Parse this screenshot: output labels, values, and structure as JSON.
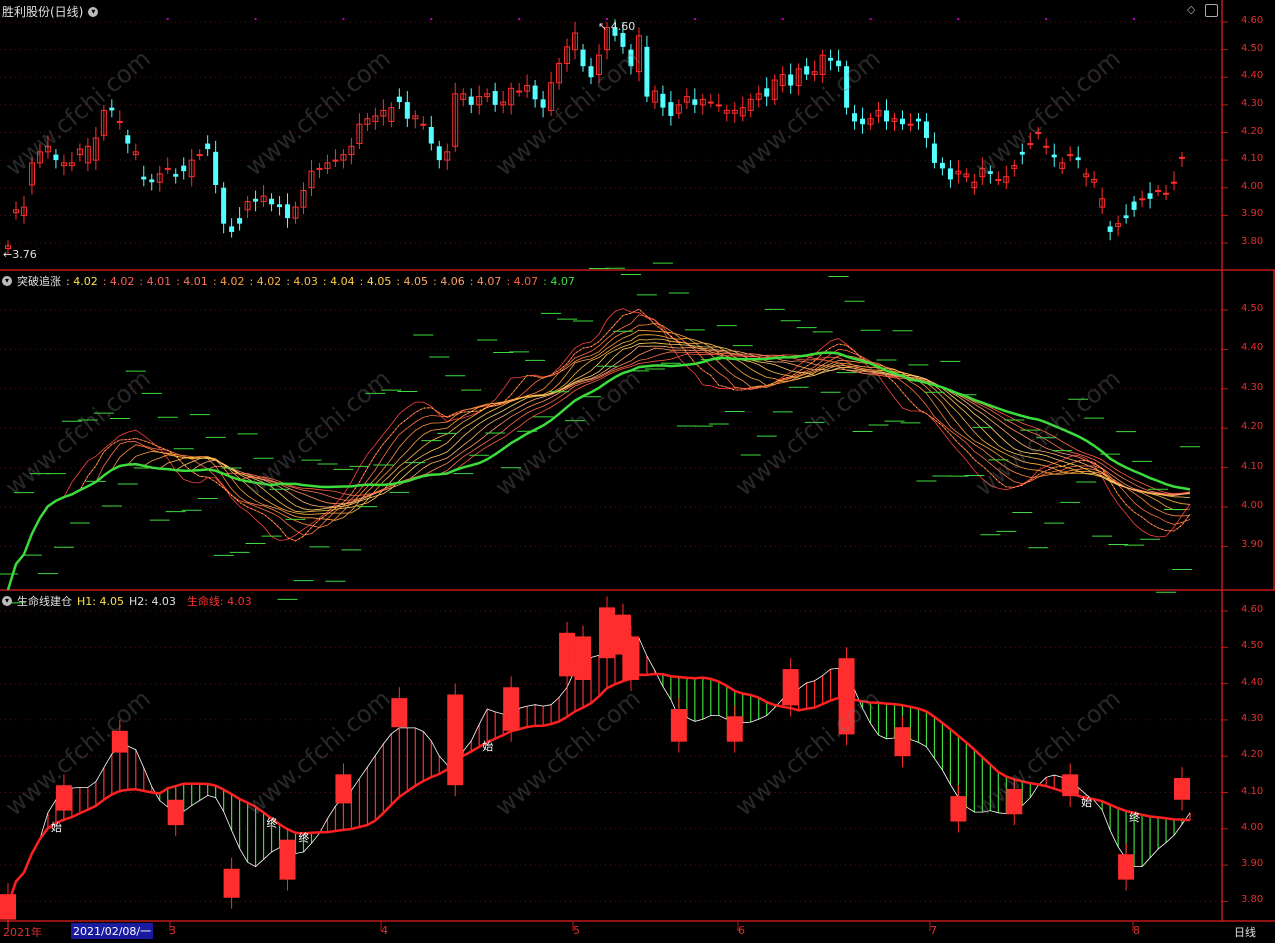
{
  "colors": {
    "up": "#ff2d2d",
    "down": "#54ffff",
    "axis": "#c01818",
    "green": "#3ddc3d",
    "white": "#ffffff",
    "purple": "#c000c0"
  },
  "panel1": {
    "title": "胜利股份(日线)",
    "label_low": "3.76",
    "label_high": "4.60",
    "yticks": [
      "4.60",
      "4.50",
      "4.40",
      "4.30",
      "4.20",
      "4.10",
      "4.00",
      "3.90",
      "3.80"
    ]
  },
  "panel2": {
    "title": "突破追涨",
    "values": [
      {
        "text": ": 4.02",
        "color": "#ffe24b"
      },
      {
        "text": ": 4.02",
        "color": "#ff6060"
      },
      {
        "text": ": 4.01",
        "color": "#ff6060"
      },
      {
        "text": ": 4.01",
        "color": "#ff7a50"
      },
      {
        "text": ": 4.02",
        "color": "#ffa040"
      },
      {
        "text": ": 4.02",
        "color": "#ffb040"
      },
      {
        "text": ": 4.03",
        "color": "#ffc040"
      },
      {
        "text": ": 4.04",
        "color": "#ffd040"
      },
      {
        "text": ": 4.05",
        "color": "#ffd050"
      },
      {
        "text": ": 4.05",
        "color": "#ffb060"
      },
      {
        "text": ": 4.06",
        "color": "#ffa070"
      },
      {
        "text": ": 4.07",
        "color": "#ff9060"
      },
      {
        "text": ": 4.07",
        "color": "#ff6040"
      },
      {
        "text": ": 4.07",
        "color": "#40e040"
      }
    ],
    "yticks": [
      "4.50",
      "4.40",
      "4.30",
      "4.20",
      "4.10",
      "4.00",
      "3.90"
    ]
  },
  "panel3": {
    "title": "生命线建仓",
    "h1": "H1: 4.05",
    "h2": "H2: 4.03",
    "life": "生命线: 4.03",
    "yticks": [
      "4.60",
      "4.50",
      "4.40",
      "4.30",
      "4.20",
      "4.10",
      "4.00",
      "3.90",
      "3.80"
    ],
    "markers": [
      "始",
      "终",
      "终",
      "始",
      "始",
      "终"
    ]
  },
  "xaxis": {
    "ticks": [
      "2021年",
      "2021/02/08/一",
      "3",
      "4",
      "5",
      "6",
      "7",
      "8"
    ],
    "period": "日线"
  },
  "watermark": "www.cfchi.com",
  "chart_data": {
    "type": "candlestick",
    "title": "胜利股份(日线)",
    "ylim": [
      3.73,
      4.64
    ],
    "close": [
      3.79,
      3.92,
      3.93,
      4.09,
      4.13,
      4.15,
      4.1,
      4.09,
      4.09,
      4.14,
      4.15,
      4.18,
      4.28,
      4.28,
      4.24,
      4.16,
      4.13,
      4.03,
      4.02,
      4.05,
      4.07,
      4.04,
      4.06,
      4.1,
      4.12,
      4.14,
      4.01,
      3.87,
      3.84,
      3.87,
      3.95,
      3.95,
      3.97,
      3.94,
      3.93,
      3.89,
      3.93,
      3.99,
      4.06,
      4.07,
      4.09,
      4.1,
      4.12,
      4.15,
      4.23,
      4.25,
      4.26,
      4.28,
      4.29,
      4.31,
      4.25,
      4.26,
      4.23,
      4.16,
      4.1,
      4.13,
      4.34,
      4.34,
      4.3,
      4.33,
      4.34,
      4.3,
      4.31,
      4.36,
      4.35,
      4.37,
      4.32,
      4.29,
      4.38,
      4.45,
      4.51,
      4.56,
      4.44,
      4.4,
      4.48,
      4.58,
      4.55,
      4.51,
      4.44,
      4.55,
      4.33,
      4.35,
      4.29,
      4.26,
      4.3,
      4.33,
      4.3,
      4.32,
      4.31,
      4.3,
      4.28,
      4.28,
      4.29,
      4.32,
      4.34,
      4.33,
      4.39,
      4.41,
      4.37,
      4.43,
      4.41,
      4.42,
      4.48,
      4.46,
      4.44,
      4.29,
      4.24,
      4.23,
      4.25,
      4.28,
      4.24,
      4.25,
      4.23,
      4.23,
      4.24,
      4.18,
      4.09,
      4.07,
      4.03,
      4.06,
      4.05,
      4.02,
      4.07,
      4.05,
      4.03,
      4.04,
      4.08,
      4.12,
      4.16,
      4.2,
      4.15,
      4.11,
      4.09,
      4.12,
      4.1,
      4.05,
      4.03,
      3.96,
      3.84,
      3.87,
      3.89,
      3.92,
      3.96,
      3.96,
      3.99,
      3.98,
      4.02,
      4.11,
      4.12
    ],
    "open": [
      3.78,
      3.91,
      3.9,
      4.01,
      4.09,
      4.13,
      4.12,
      4.08,
      4.08,
      4.12,
      4.09,
      4.1,
      4.19,
      4.29,
      4.24,
      4.19,
      4.12,
      4.04,
      4.03,
      4.02,
      4.07,
      4.05,
      4.08,
      4.04,
      4.12,
      4.16,
      4.13,
      4.0,
      3.86,
      3.89,
      3.92,
      3.96,
      3.95,
      3.96,
      3.94,
      3.94,
      3.89,
      3.93,
      4.0,
      4.07,
      4.07,
      4.1,
      4.1,
      4.12,
      4.16,
      4.23,
      4.24,
      4.26,
      4.24,
      4.33,
      4.31,
      4.25,
      4.23,
      4.22,
      4.15,
      4.1,
      4.15,
      4.32,
      4.33,
      4.3,
      4.33,
      4.35,
      4.3,
      4.3,
      4.35,
      4.35,
      4.37,
      4.32,
      4.28,
      4.38,
      4.45,
      4.5,
      4.5,
      4.44,
      4.41,
      4.5,
      4.58,
      4.56,
      4.5,
      4.42,
      4.51,
      4.31,
      4.34,
      4.31,
      4.27,
      4.31,
      4.32,
      4.3,
      4.31,
      4.3,
      4.27,
      4.27,
      4.26,
      4.28,
      4.32,
      4.36,
      4.32,
      4.37,
      4.41,
      4.37,
      4.44,
      4.41,
      4.41,
      4.47,
      4.46,
      4.44,
      4.27,
      4.25,
      4.23,
      4.26,
      4.28,
      4.24,
      4.25,
      4.23,
      4.25,
      4.24,
      4.16,
      4.09,
      4.07,
      4.05,
      4.04,
      4.0,
      4.04,
      4.06,
      4.03,
      4.02,
      4.07,
      4.13,
      4.16,
      4.2,
      4.15,
      4.12,
      4.07,
      4.12,
      4.11,
      4.04,
      4.02,
      3.93,
      3.86,
      3.86,
      3.9,
      3.95,
      3.96,
      3.98,
      3.99,
      3.98,
      4.02,
      4.11
    ]
  }
}
